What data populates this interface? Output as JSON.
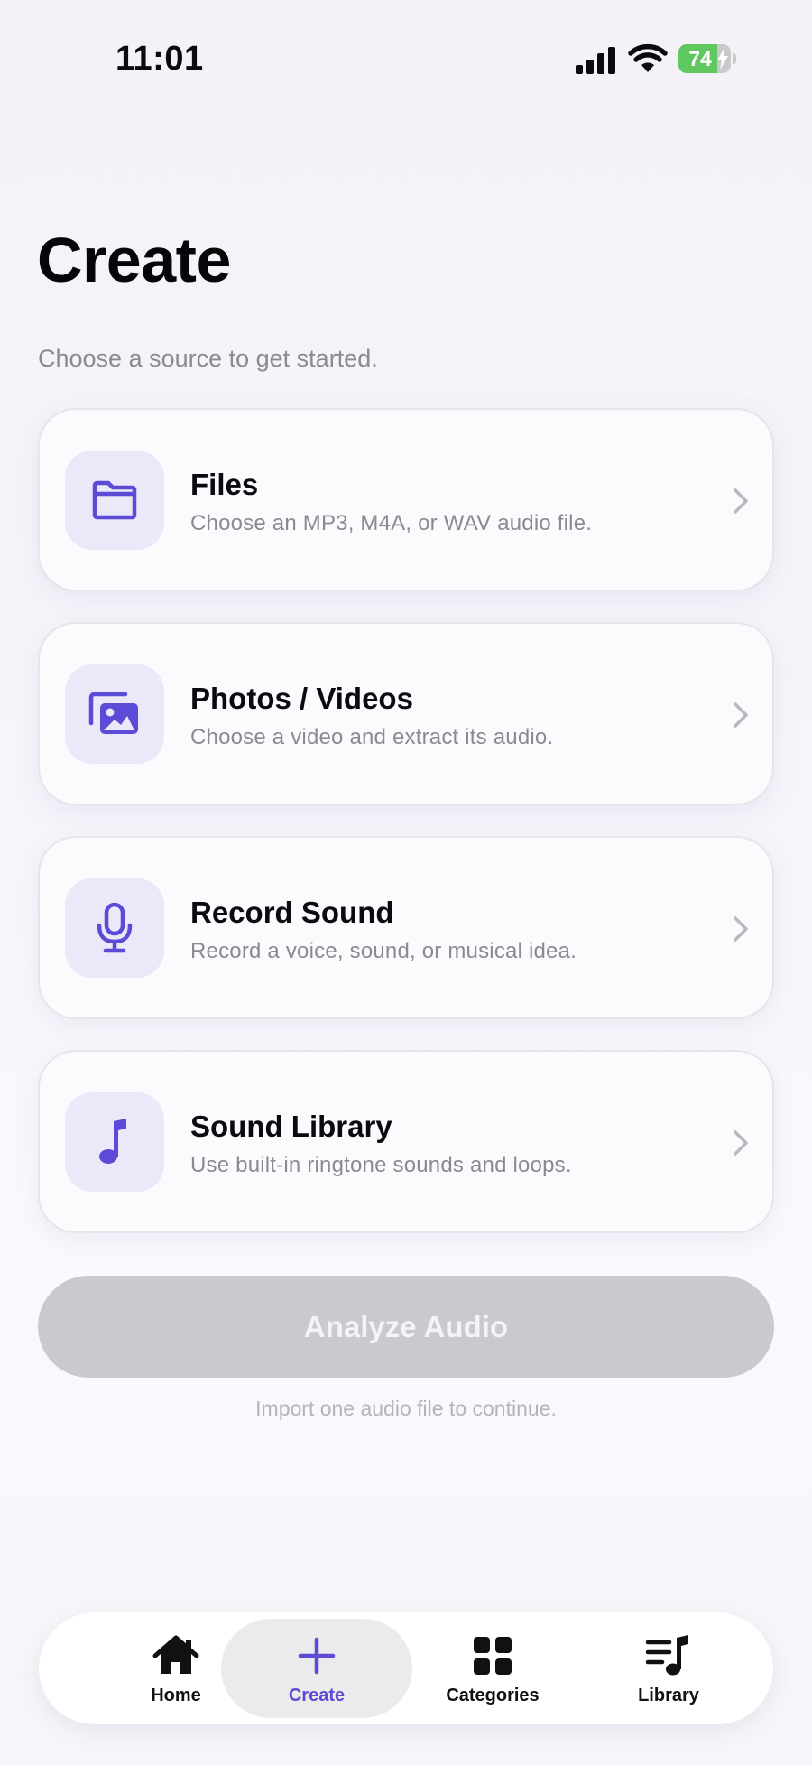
{
  "status_bar": {
    "time": "11:01",
    "battery_level": "74",
    "battery_fraction": 0.74,
    "icons": [
      "signal-icon",
      "wifi-icon",
      "battery-icon",
      "charging-bolt-icon"
    ]
  },
  "header": {
    "title": "Create",
    "subtitle": "Choose a source to get started."
  },
  "sources": [
    {
      "title": "Files",
      "description": "Choose an MP3, M4A, or WAV audio file.",
      "icon": "folder-icon"
    },
    {
      "title": "Photos / Videos",
      "description": "Choose a video and extract its audio.",
      "icon": "photos-icon"
    },
    {
      "title": "Record Sound",
      "description": "Record a voice, sound, or musical idea.",
      "icon": "microphone-icon"
    },
    {
      "title": "Sound Library",
      "description": "Use built-in ringtone sounds and loops.",
      "icon": "music-note-icon"
    }
  ],
  "analyze": {
    "label": "Analyze Audio",
    "hint": "Import one audio file to continue."
  },
  "tabs": [
    {
      "label": "Home",
      "icon": "home-icon",
      "active": false
    },
    {
      "label": "Create",
      "icon": "plus-icon",
      "active": true
    },
    {
      "label": "Categories",
      "icon": "grid-icon",
      "active": false
    },
    {
      "label": "Library",
      "icon": "music-list-icon",
      "active": false
    }
  ],
  "colors": {
    "accent": "#5b4bd6",
    "icon_background": "#ebe8fa",
    "battery_green": "#5fc85f",
    "disabled_button": "#c9c9ce"
  }
}
